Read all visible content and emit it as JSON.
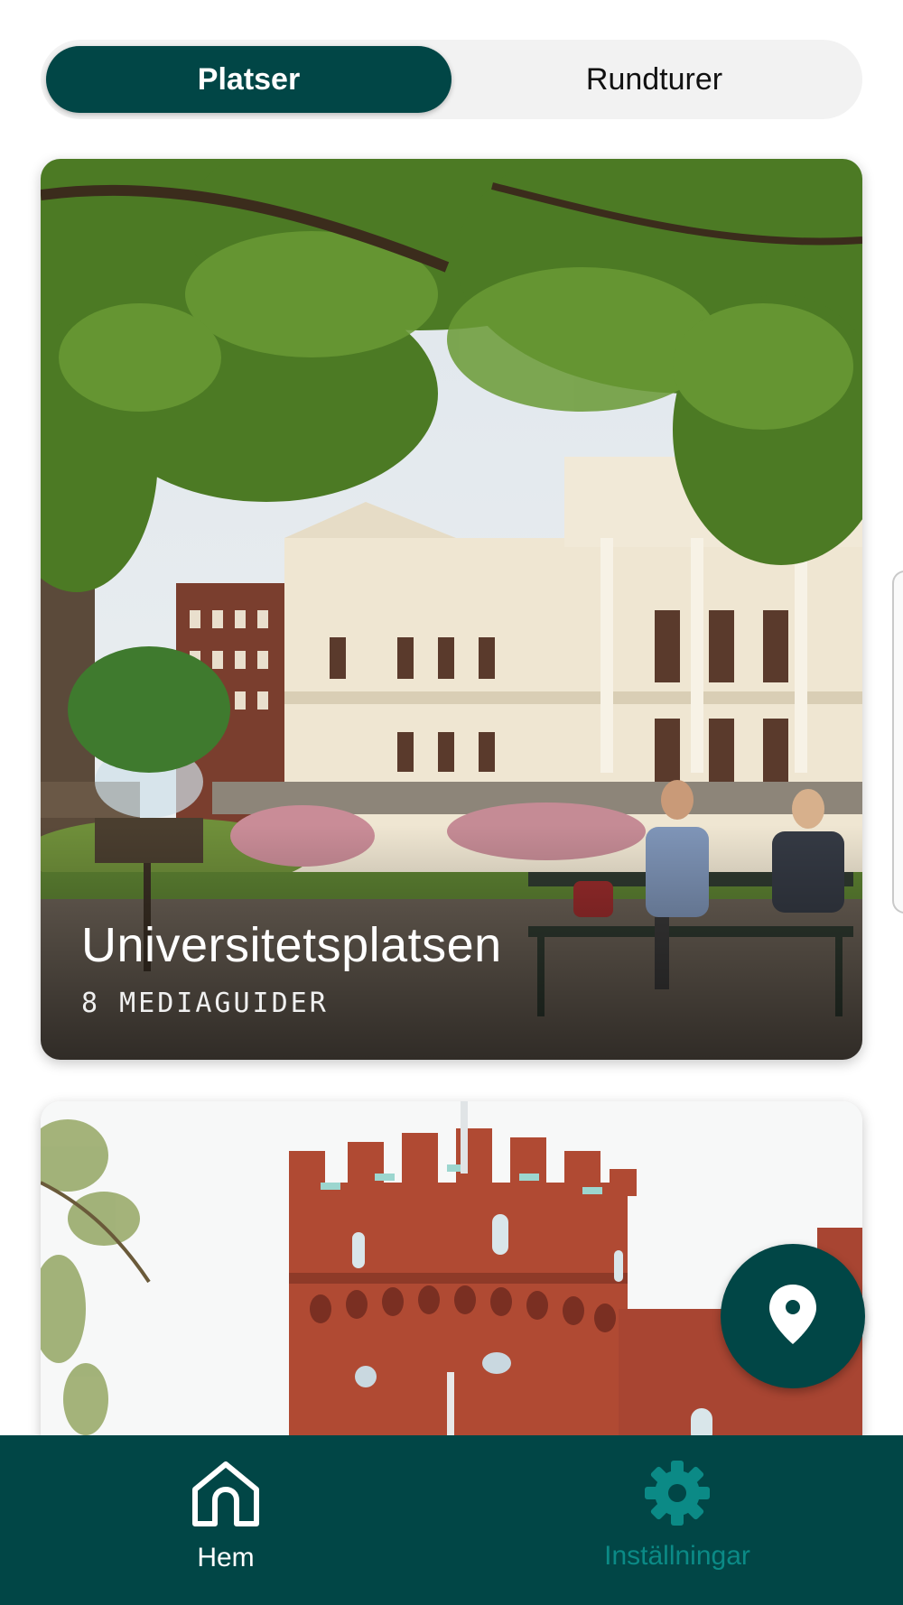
{
  "segmented": {
    "places_label": "Platser",
    "tours_label": "Rundturer",
    "selected": "Platser"
  },
  "cards": [
    {
      "title": "Universitetsplatsen",
      "subtitle": "8 MEDIAGUIDER"
    },
    {
      "title": "",
      "subtitle": ""
    }
  ],
  "bottom_nav": {
    "home_label": "Hem",
    "settings_label": "Inställningar",
    "active": "Hem"
  },
  "colors": {
    "brand": "#014646",
    "inactive_nav": "#0b8a86",
    "segment_track": "#f2f2f2"
  },
  "icons": {
    "fab": "location-pin-icon",
    "home": "home-icon",
    "settings": "gear-icon"
  }
}
